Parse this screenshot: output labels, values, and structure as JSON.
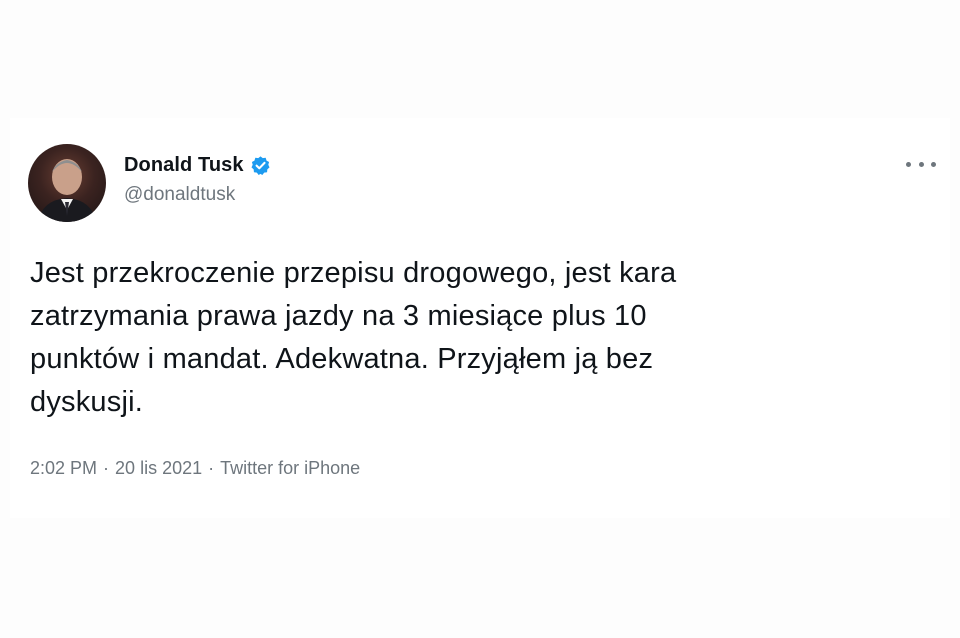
{
  "author": {
    "display_name": "Donald Tusk",
    "handle": "@donaldtusk",
    "verified": true,
    "avatar_icon": "profile-photo"
  },
  "more_icon": "more-horizontal-icon",
  "tweet": {
    "lines": [
      "Jest przekroczenie przepisu drogowego, jest kara",
      "zatrzymania prawa jazdy na 3 miesiące plus 10",
      "punktów i mandat. Adekwatna. Przyjąłem ją bez",
      "dyskusji."
    ]
  },
  "meta": {
    "time": "2:02 PM",
    "separator1": "·",
    "date": "20 lis 2021",
    "separator2": "·",
    "source": "Twitter for iPhone"
  },
  "colors": {
    "text_primary": "#0f1419",
    "text_secondary": "#6e767d",
    "verified_blue": "#1d9bf0"
  }
}
